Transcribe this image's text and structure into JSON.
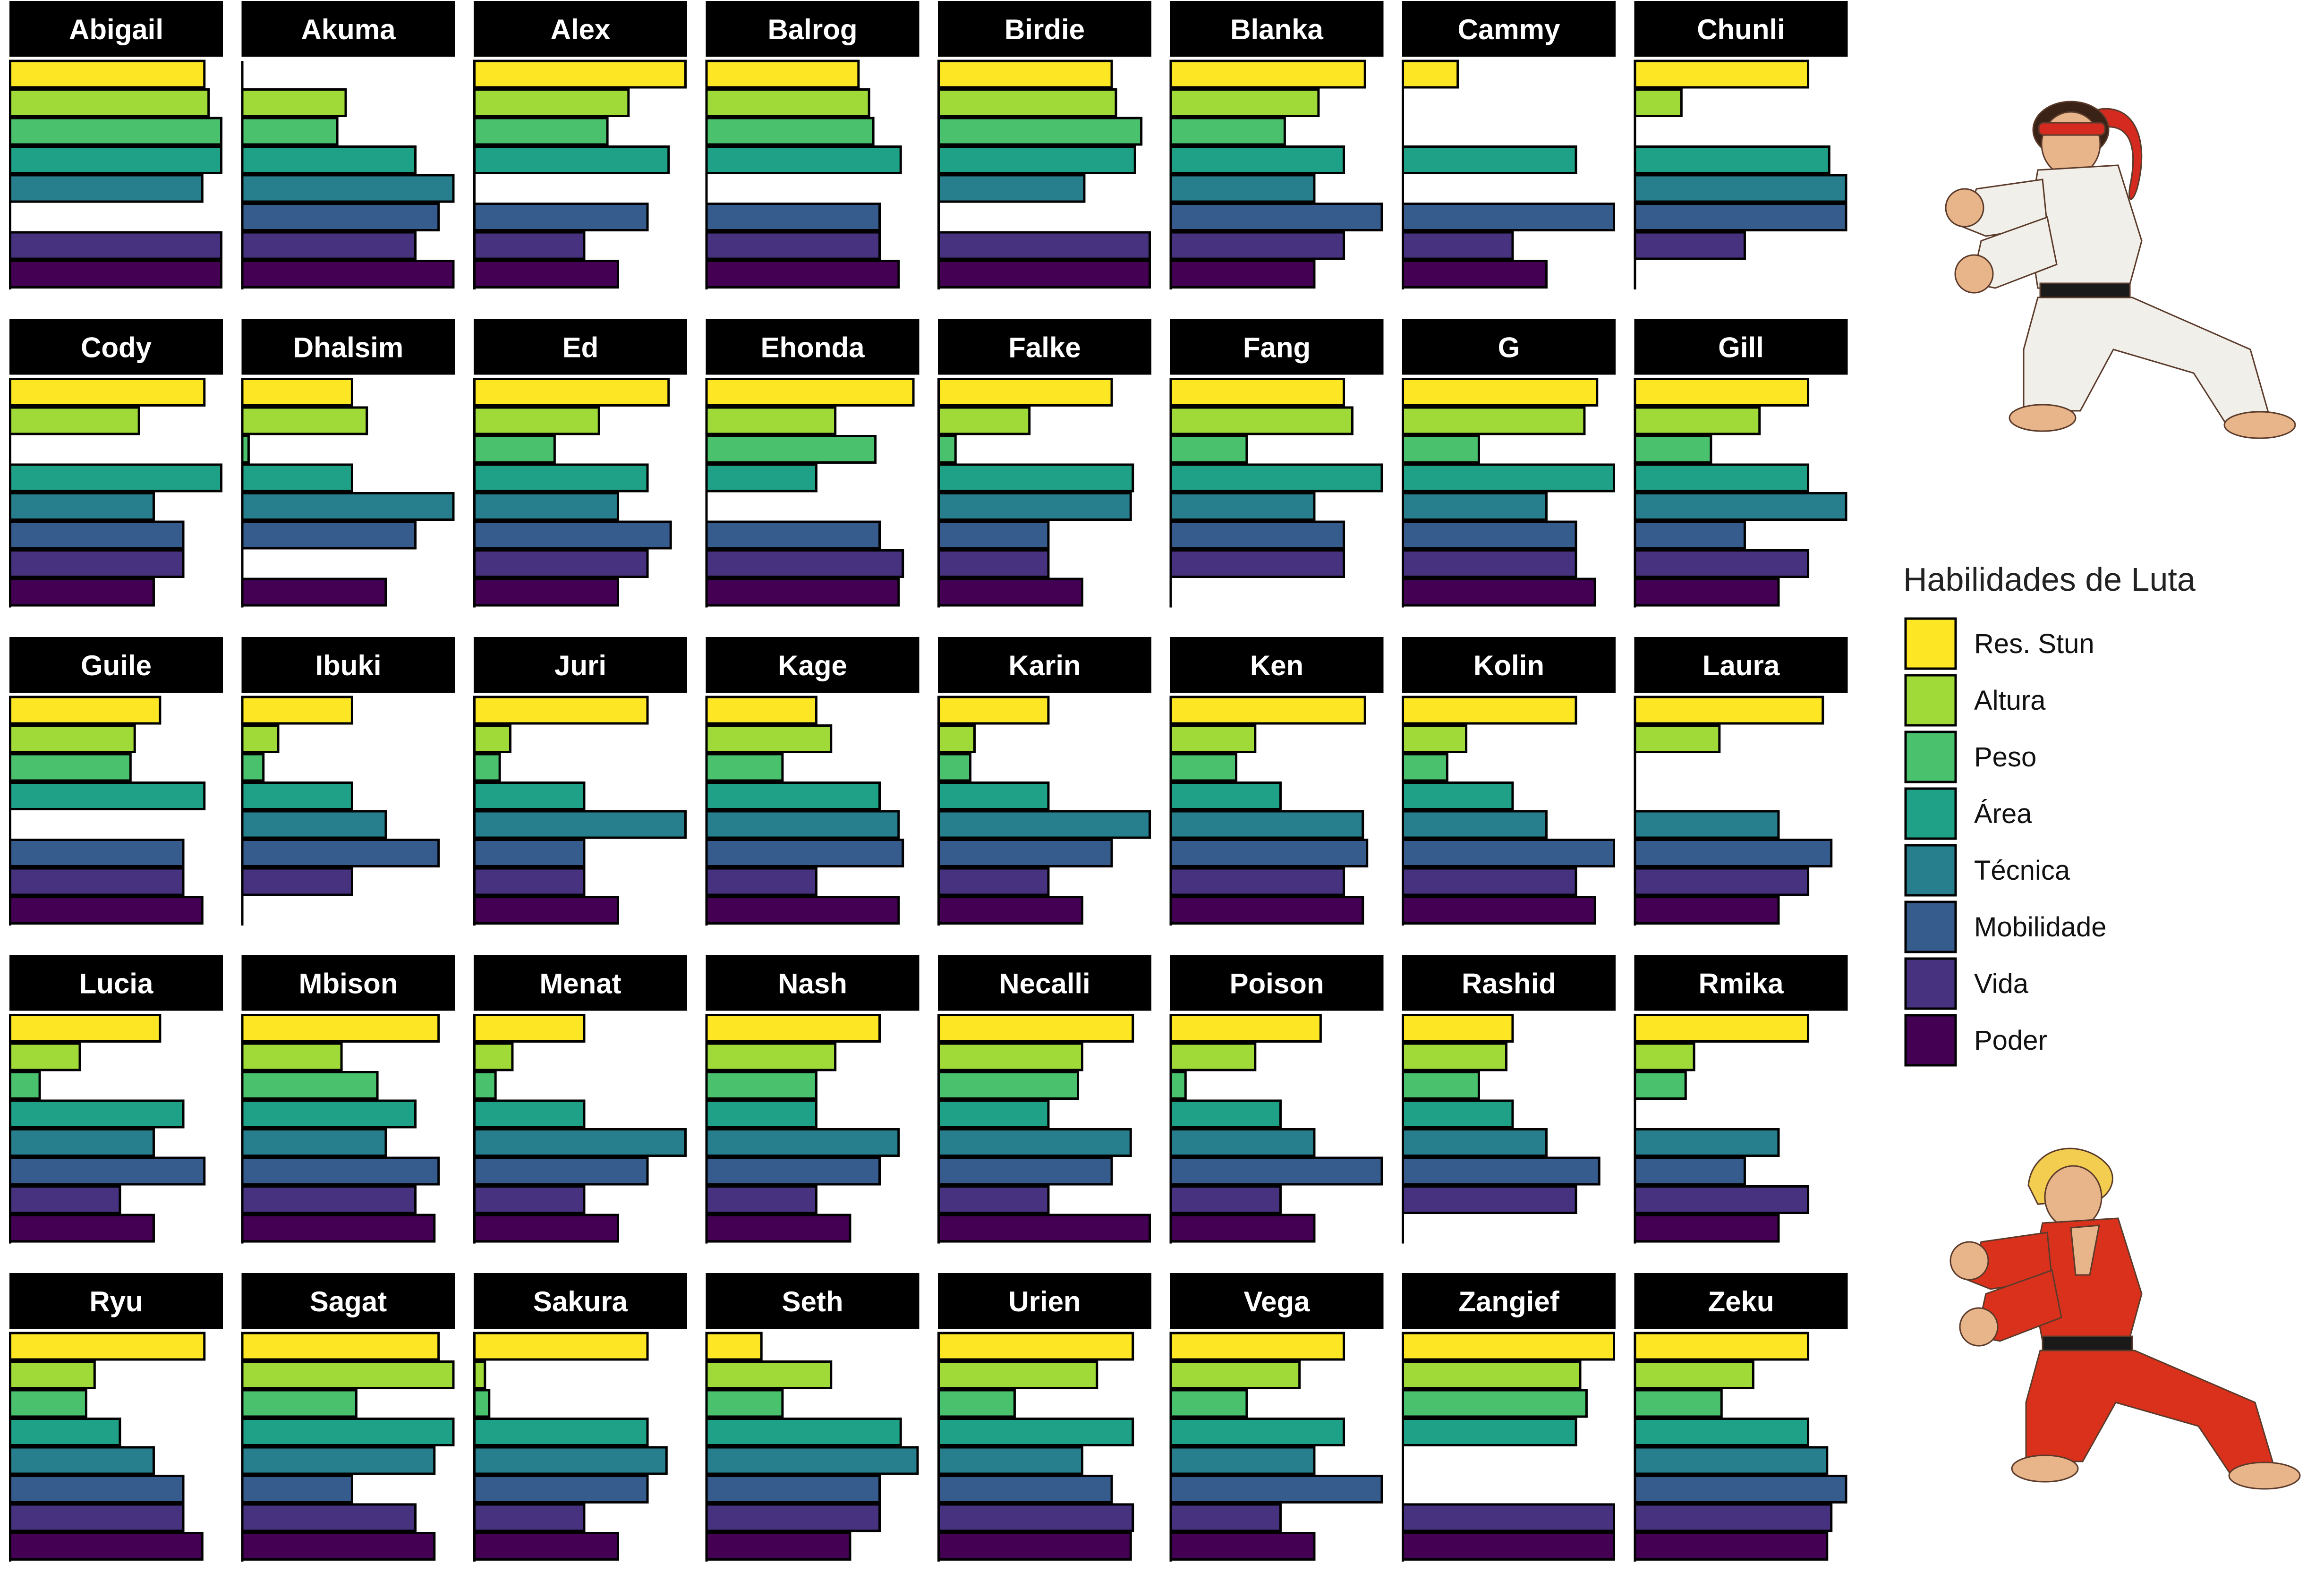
{
  "chart_data": {
    "type": "bar",
    "orientation": "horizontal",
    "facet": "small-multiples",
    "series_names": [
      "Res. Stun",
      "Altura",
      "Peso",
      "Área",
      "Técnica",
      "Mobilidade",
      "Vida",
      "Poder"
    ],
    "colors": [
      "#fde725",
      "#a0da39",
      "#4ac16d",
      "#1fa187",
      "#277f8e",
      "#365c8d",
      "#46327e",
      "#440154"
    ],
    "xlim": [
      0,
      1
    ],
    "grid": false,
    "legend_position": "right",
    "legend_title": "Habilidades de Luta",
    "panels": [
      {
        "name": "Abigail",
        "values": [
          0.92,
          0.94,
          1.0,
          1.0,
          0.91,
          0.0,
          1.0,
          1.0
        ]
      },
      {
        "name": "Akuma",
        "values": [
          0.0,
          0.49,
          0.45,
          0.82,
          1.0,
          0.93,
          0.82,
          1.0
        ]
      },
      {
        "name": "Alex",
        "values": [
          1.0,
          0.73,
          0.63,
          0.92,
          0.0,
          0.82,
          0.52,
          0.68
        ]
      },
      {
        "name": "Balrog",
        "values": [
          0.72,
          0.77,
          0.79,
          0.92,
          0.0,
          0.82,
          0.82,
          0.91
        ]
      },
      {
        "name": "Birdie",
        "values": [
          0.82,
          0.84,
          0.96,
          0.93,
          0.69,
          0.0,
          1.0,
          1.0
        ]
      },
      {
        "name": "Blanka",
        "values": [
          0.92,
          0.7,
          0.54,
          0.82,
          0.68,
          1.0,
          0.82,
          0.68
        ]
      },
      {
        "name": "Cammy",
        "values": [
          0.26,
          0.0,
          0.0,
          0.82,
          0.0,
          1.0,
          0.52,
          0.68
        ]
      },
      {
        "name": "Chunli",
        "values": [
          0.82,
          0.22,
          0.0,
          0.92,
          1.0,
          1.0,
          0.52,
          0.0
        ]
      },
      {
        "name": "Cody",
        "values": [
          0.92,
          0.61,
          0.0,
          1.0,
          0.68,
          0.82,
          0.82,
          0.68
        ]
      },
      {
        "name": "Dhalsim",
        "values": [
          0.52,
          0.59,
          0.03,
          0.52,
          1.0,
          0.82,
          0.0,
          0.68
        ]
      },
      {
        "name": "Ed",
        "values": [
          0.92,
          0.59,
          0.38,
          0.82,
          0.68,
          0.93,
          0.82,
          0.68
        ]
      },
      {
        "name": "Ehonda",
        "values": [
          0.98,
          0.61,
          0.8,
          0.52,
          0.0,
          0.82,
          0.93,
          0.91
        ]
      },
      {
        "name": "Falke",
        "values": [
          0.82,
          0.43,
          0.08,
          0.92,
          0.91,
          0.52,
          0.52,
          0.68
        ]
      },
      {
        "name": "Fang",
        "values": [
          0.82,
          0.86,
          0.36,
          1.0,
          0.68,
          0.82,
          0.82,
          0.0
        ]
      },
      {
        "name": "G",
        "values": [
          0.92,
          0.86,
          0.36,
          1.0,
          0.68,
          0.82,
          0.82,
          0.91
        ]
      },
      {
        "name": "Gill",
        "values": [
          0.82,
          0.59,
          0.36,
          0.82,
          1.0,
          0.52,
          0.82,
          0.68
        ]
      },
      {
        "name": "Guile",
        "values": [
          0.71,
          0.59,
          0.57,
          0.92,
          0.0,
          0.82,
          0.82,
          0.91
        ]
      },
      {
        "name": "Ibuki",
        "values": [
          0.52,
          0.17,
          0.1,
          0.52,
          0.68,
          0.93,
          0.52,
          0.0
        ]
      },
      {
        "name": "Juri",
        "values": [
          0.82,
          0.17,
          0.12,
          0.52,
          1.0,
          0.52,
          0.52,
          0.68
        ]
      },
      {
        "name": "Kage",
        "values": [
          0.52,
          0.59,
          0.36,
          0.82,
          0.91,
          0.93,
          0.52,
          0.91
        ]
      },
      {
        "name": "Karin",
        "values": [
          0.52,
          0.17,
          0.15,
          0.52,
          1.0,
          0.82,
          0.52,
          0.68
        ]
      },
      {
        "name": "Ken",
        "values": [
          0.92,
          0.4,
          0.31,
          0.52,
          0.91,
          0.93,
          0.82,
          0.91
        ]
      },
      {
        "name": "Kolin",
        "values": [
          0.82,
          0.3,
          0.21,
          0.52,
          0.68,
          1.0,
          0.82,
          0.91
        ]
      },
      {
        "name": "Laura",
        "values": [
          0.89,
          0.4,
          0.0,
          0.0,
          0.68,
          0.93,
          0.82,
          0.68
        ]
      },
      {
        "name": "Lucia",
        "values": [
          0.71,
          0.33,
          0.14,
          0.82,
          0.68,
          0.92,
          0.52,
          0.68
        ]
      },
      {
        "name": "Mbison",
        "values": [
          0.93,
          0.47,
          0.64,
          0.82,
          0.68,
          0.93,
          0.82,
          0.91
        ]
      },
      {
        "name": "Menat",
        "values": [
          0.52,
          0.18,
          0.1,
          0.52,
          1.0,
          0.82,
          0.52,
          0.68
        ]
      },
      {
        "name": "Nash",
        "values": [
          0.82,
          0.61,
          0.52,
          0.52,
          0.91,
          0.82,
          0.52,
          0.68
        ]
      },
      {
        "name": "Necalli",
        "values": [
          0.92,
          0.68,
          0.66,
          0.52,
          0.91,
          0.82,
          0.52,
          1.0
        ]
      },
      {
        "name": "Poison",
        "values": [
          0.71,
          0.4,
          0.07,
          0.52,
          0.68,
          1.0,
          0.52,
          0.68
        ]
      },
      {
        "name": "Rashid",
        "values": [
          0.52,
          0.49,
          0.36,
          0.52,
          0.68,
          0.93,
          0.82,
          0.0
        ]
      },
      {
        "name": "Rmika",
        "values": [
          0.82,
          0.28,
          0.24,
          0.0,
          0.68,
          0.52,
          0.82,
          0.68
        ]
      },
      {
        "name": "Ryu",
        "values": [
          0.92,
          0.4,
          0.36,
          0.52,
          0.68,
          0.82,
          0.82,
          0.91
        ]
      },
      {
        "name": "Sagat",
        "values": [
          0.93,
          1.0,
          0.54,
          1.0,
          0.91,
          0.52,
          0.82,
          0.91
        ]
      },
      {
        "name": "Sakura",
        "values": [
          0.82,
          0.05,
          0.07,
          0.82,
          0.91,
          0.82,
          0.52,
          0.68
        ]
      },
      {
        "name": "Seth",
        "values": [
          0.26,
          0.59,
          0.36,
          0.92,
          1.0,
          0.82,
          0.82,
          0.68
        ]
      },
      {
        "name": "Urien",
        "values": [
          0.92,
          0.75,
          0.36,
          0.92,
          0.68,
          0.82,
          0.92,
          0.91
        ]
      },
      {
        "name": "Vega",
        "values": [
          0.82,
          0.61,
          0.36,
          0.82,
          0.68,
          1.0,
          0.52,
          0.68
        ]
      },
      {
        "name": "Zangief",
        "values": [
          1.0,
          0.84,
          0.87,
          0.82,
          0.0,
          0.0,
          1.0,
          1.0
        ]
      },
      {
        "name": "Zeku",
        "values": [
          0.82,
          0.56,
          0.41,
          0.82,
          0.91,
          1.0,
          0.93,
          0.91
        ]
      }
    ]
  },
  "sprites": [
    {
      "name": "Ryu",
      "gi_color": "#f1efe9",
      "headband_color": "#d42a1f",
      "belt_color": "#1a1a1a",
      "skin_color": "#e8b48a",
      "hair_color": "#3b2216"
    },
    {
      "name": "Ken",
      "gi_color": "#d9311c",
      "headband_color": "#d9311c",
      "belt_color": "#1a1a1a",
      "skin_color": "#e8b48a",
      "hair_color": "#f2cd4f"
    }
  ]
}
